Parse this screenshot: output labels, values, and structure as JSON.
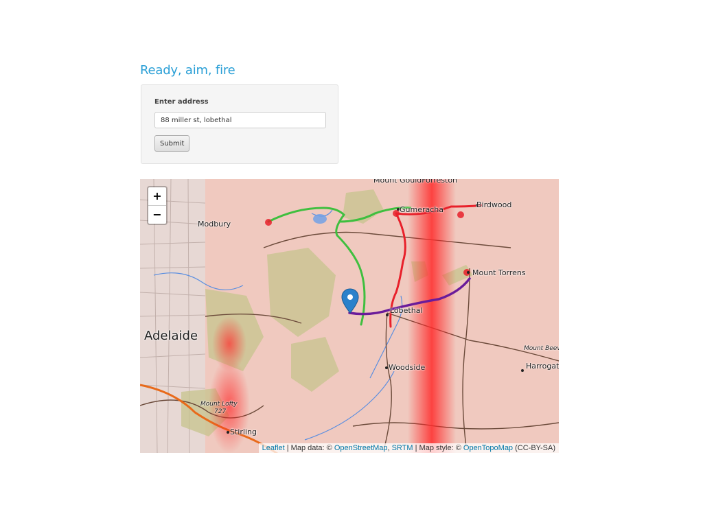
{
  "page": {
    "title": "Ready, aim, fire"
  },
  "form": {
    "label": "Enter address",
    "address_value": "88 miller st, lobethal",
    "submit_label": "Submit"
  },
  "map": {
    "zoom_in_label": "+",
    "zoom_out_label": "−",
    "attribution": {
      "leaflet": "Leaflet",
      "sep1": " | Map data: © ",
      "osm": "OpenStreetMap",
      "sep2": ", ",
      "srtm": "SRTM",
      "sep3": " | Map style: © ",
      "otm": "OpenTopoMap",
      "sep4": " (CC-BY-SA)"
    },
    "places": {
      "mount_gould_forreston": "Mount GouldForreston",
      "gumeracha": "Gumeracha",
      "birdwood": "Birdwood",
      "modbury": "Modbury",
      "mount_torrens": "Mount Torrens",
      "lobethal": "Lobethal",
      "adelaide": "Adelaide",
      "mount_beevor": "Mount Beev",
      "harrogate": "Harrogat",
      "woodside": "Woodside",
      "mount_lofty": "Mount Lofty",
      "mount_lofty_height": "727",
      "stirling": "Stirling"
    },
    "colors": {
      "route_green": "#3fbf3f",
      "route_red": "#e8202a",
      "route_purple": "#6a1b9a",
      "marker_blue": "#2a81cb",
      "fire_red": "#ff2a2a"
    }
  }
}
